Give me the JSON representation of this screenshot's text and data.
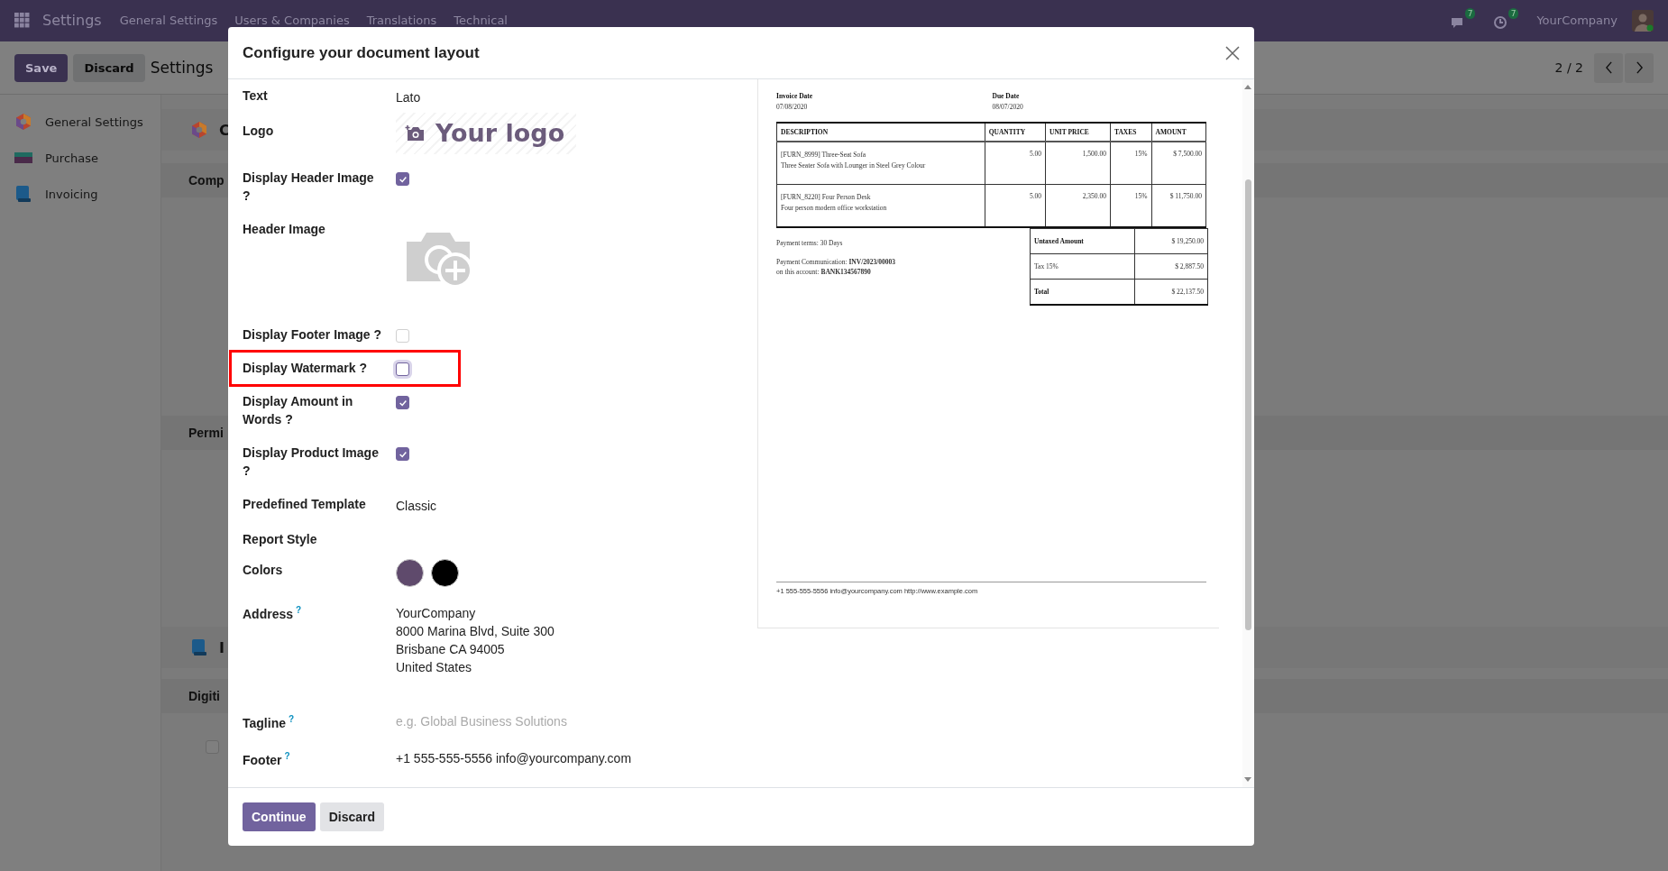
{
  "navbar": {
    "app": "Settings",
    "menu": [
      "General Settings",
      "Users & Companies",
      "Translations",
      "Technical"
    ],
    "chat_count": "7",
    "activity_count": "7",
    "company": "YourCompany"
  },
  "control_panel": {
    "save": "Save",
    "discard": "Discard",
    "breadcrumb": "Settings",
    "pager": "2 / 2"
  },
  "sidebar": {
    "items": [
      {
        "label": "General Settings",
        "kind": "general"
      },
      {
        "label": "Purchase",
        "kind": "purchase"
      },
      {
        "label": "Invoicing",
        "kind": "invoicing"
      }
    ]
  },
  "sections": [
    {
      "kind": "app",
      "title": "C"
    },
    {
      "kind": "heading",
      "title": "Comp"
    },
    {
      "kind": "heading",
      "title": "Permi"
    },
    {
      "kind": "app",
      "title": "I"
    },
    {
      "kind": "heading",
      "title": "Digiti"
    },
    {
      "kind": "checkbox",
      "checked": false
    }
  ],
  "dialog": {
    "title": "Configure your document layout",
    "fields": [
      {
        "kind": "text",
        "label": "Text",
        "value": "Lato"
      },
      {
        "kind": "logo",
        "label": "Logo",
        "value": "Your logo"
      },
      {
        "kind": "checkbox",
        "label": "Display Header Image ?",
        "checked": true,
        "highlighted": false
      },
      {
        "kind": "image",
        "label": "Header Image"
      },
      {
        "kind": "checkbox",
        "label": "Display Footer Image ?",
        "checked": false,
        "highlighted": false
      },
      {
        "kind": "checkbox",
        "label": "Display Watermark ?",
        "checked": false,
        "highlighted": true
      },
      {
        "kind": "checkbox",
        "label": "Display Amount in Words ?",
        "checked": true,
        "highlighted": false
      },
      {
        "kind": "checkbox",
        "label": "Display Product Image ?",
        "checked": true,
        "highlighted": false
      },
      {
        "kind": "text",
        "label": "Predefined Template",
        "value": "Classic"
      },
      {
        "kind": "empty",
        "label": "Report Style"
      },
      {
        "kind": "colors",
        "label": "Colors",
        "colors": [
          {
            "color": "#5f4a6c"
          },
          {
            "color": "#000000"
          }
        ]
      },
      {
        "kind": "lines",
        "label": "Address",
        "help": "?",
        "lines": [
          "YourCompany",
          "8000 Marina Blvd, Suite 300",
          "Brisbane CA 94005",
          "United States"
        ]
      },
      {
        "kind": "input",
        "label": "Tagline",
        "help": "?",
        "placeholder": "e.g. Global Business Solutions"
      },
      {
        "kind": "text",
        "label": "Footer",
        "help": "?",
        "value": "+1 555-555-5556 info@yourcompany.com"
      }
    ],
    "preview": {
      "dates": [
        {
          "label": "Invoice Date",
          "value": "07/08/2020"
        },
        {
          "label": "Due Date",
          "value": "08/07/2020"
        }
      ],
      "columns": [
        "DESCRIPTION",
        "QUANTITY",
        "UNIT PRICE",
        "TAXES",
        "AMOUNT"
      ],
      "rows": [
        {
          "description": "[FURN_8999] Three-Seat Sofa",
          "note": "Three Seater Sofa with Lounger in Steel Grey Colour",
          "quantity": "5.00",
          "unit_price": "1,500.00",
          "taxes": "15%",
          "amount": "$ 7,500.00"
        },
        {
          "description": "[FURN_8220] Four Person Desk",
          "note": "Four person modern office workstation",
          "quantity": "5.00",
          "unit_price": "2,350.00",
          "taxes": "15%",
          "amount": "$ 11,750.00"
        }
      ],
      "payment_terms": "Payment terms: 30 Days",
      "communication": "Payment Communication: **INV/2023/00003**",
      "account": "on this account: **BANK134567890**",
      "totals": [
        {
          "label": "Untaxed Amount",
          "value": "$ 19,250.00",
          "bold": true
        },
        {
          "label": "Tax 15%",
          "value": "$ 2,887.50",
          "bold": false
        },
        {
          "label": "Total",
          "value": "$ 22,137.50",
          "bold": true
        }
      ],
      "footer": "+1 555-555-5556 info@yourcompany.com http://www.example.com"
    },
    "buttons": [
      {
        "label": "Continue",
        "kind": "primary"
      },
      {
        "label": "Discard",
        "kind": "secondary"
      }
    ]
  }
}
